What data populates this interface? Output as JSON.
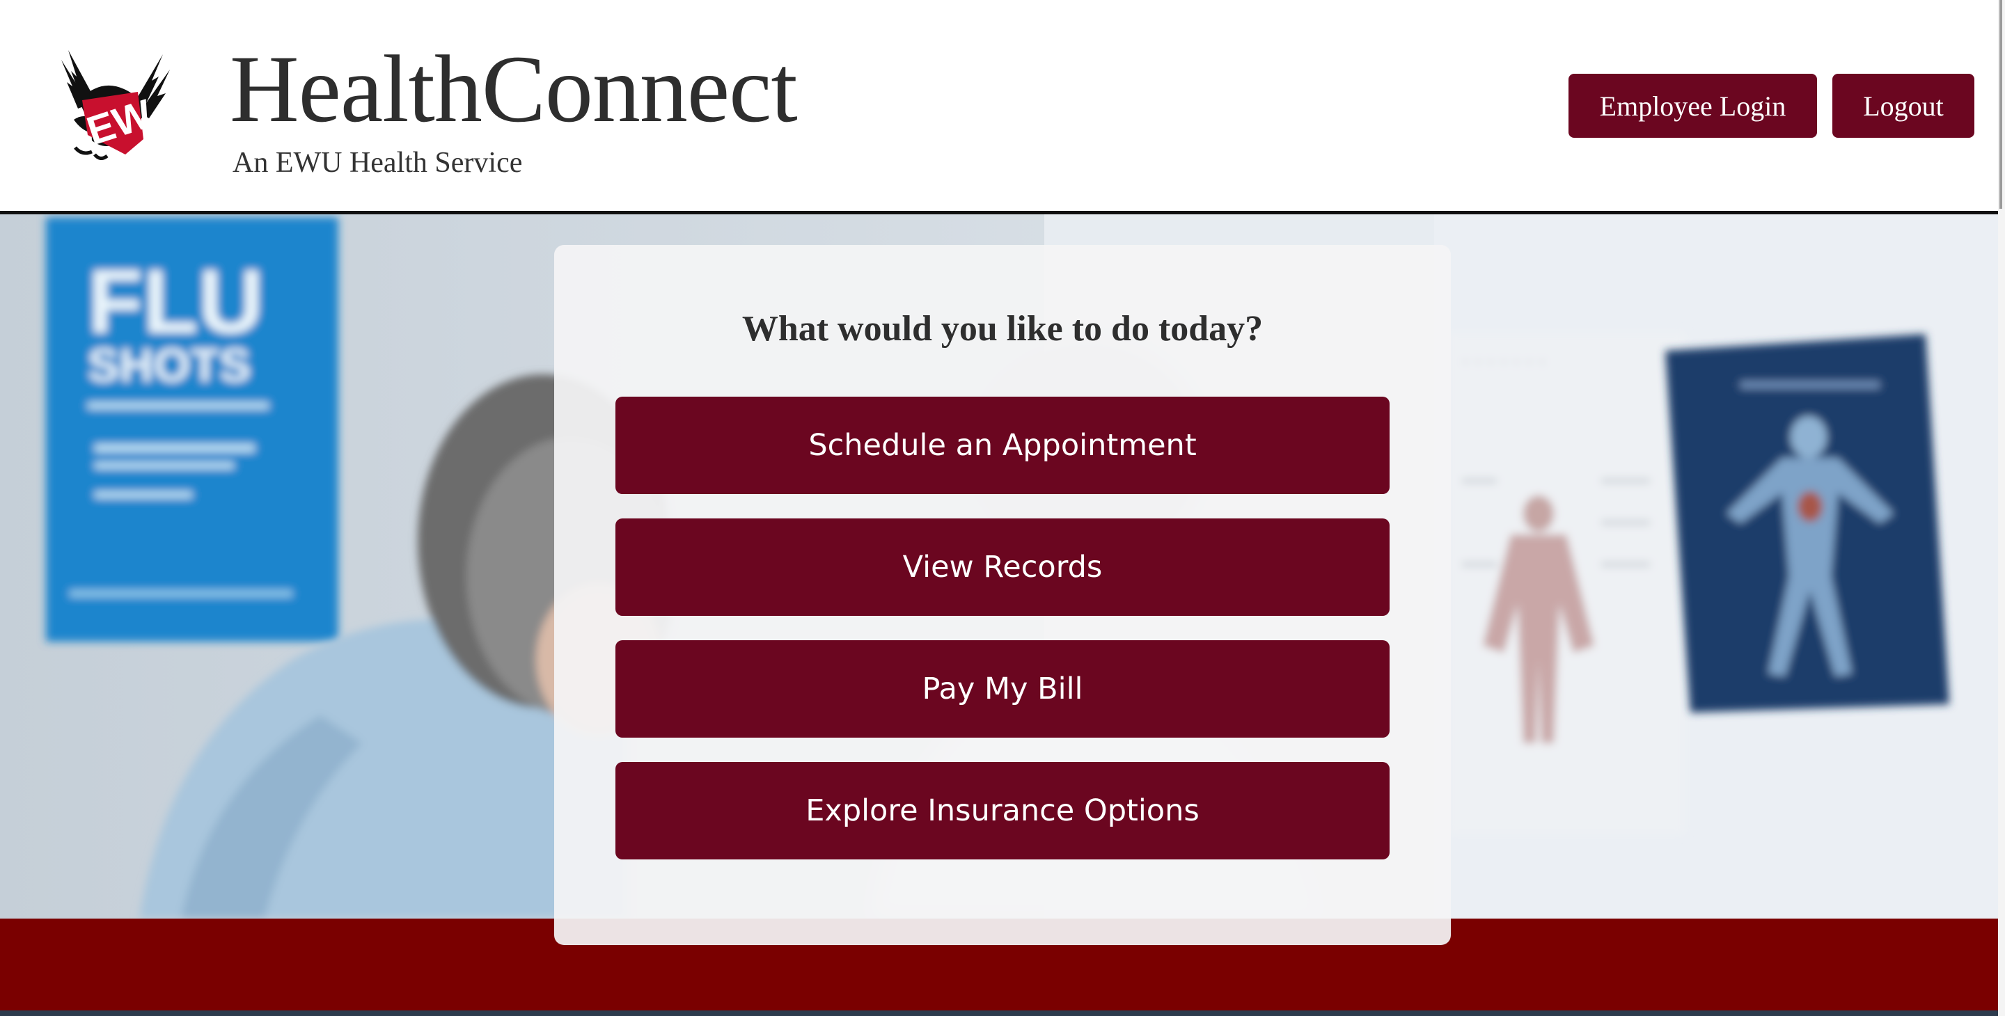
{
  "header": {
    "title": "HealthConnect",
    "subtitle": "An EWU Health Service",
    "logo_text": "EW",
    "employee_login_label": "Employee Login",
    "logout_label": "Logout"
  },
  "hero": {
    "poster_text_line1": "FLU",
    "poster_text_line2": "SHOTS"
  },
  "card": {
    "question": "What would you like to do today?",
    "actions": [
      {
        "label": "Schedule an Appointment"
      },
      {
        "label": "View Records"
      },
      {
        "label": "Pay My Bill"
      },
      {
        "label": "Explore Insurance Options"
      }
    ]
  },
  "colors": {
    "brand_maroon": "#6b0620",
    "footer_red": "#7a0000",
    "ewu_red": "#c8102e"
  }
}
